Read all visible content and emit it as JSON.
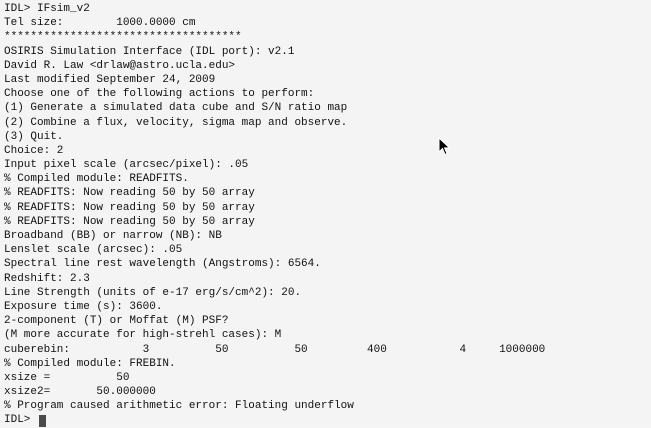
{
  "terminal": {
    "lines": [
      "IDL> IFsim_v2",
      "Tel size:        1000.0000 cm",
      "************************************",
      "OSIRIS Simulation Interface (IDL port): v2.1",
      "David R. Law <drlaw@astro.ucla.edu>",
      "Last modified September 24, 2009",
      "Choose one of the following actions to perform:",
      "(1) Generate a simulated data cube and S/N ratio map",
      "(2) Combine a flux, velocity, sigma map and observe.",
      "(3) Quit.",
      "Choice: 2",
      "Input pixel scale (arcsec/pixel): .05",
      "% Compiled module: READFITS.",
      "% READFITS: Now reading 50 by 50 array",
      "% READFITS: Now reading 50 by 50 array",
      "% READFITS: Now reading 50 by 50 array",
      "Broadband (BB) or narrow (NB): NB",
      "Lenslet scale (arcsec): .05",
      "Spectral line rest wavelength (Angstroms): 6564.",
      "Redshift: 2.3",
      "Line Strength (units of e-17 erg/s/cm^2): 20.",
      "Exposure time (s): 3600.",
      "2-component (T) or Moffat (M) PSF?",
      "(M more accurate for high-strehl cases): M",
      "cuberebin:           3          50          50         400           4     1000000",
      "% Compiled module: FREBIN.",
      "xsize =          50",
      "xsize2=       50.000000",
      "% Program caused arithmetic error: Floating underflow"
    ],
    "prompt": "IDL> "
  }
}
